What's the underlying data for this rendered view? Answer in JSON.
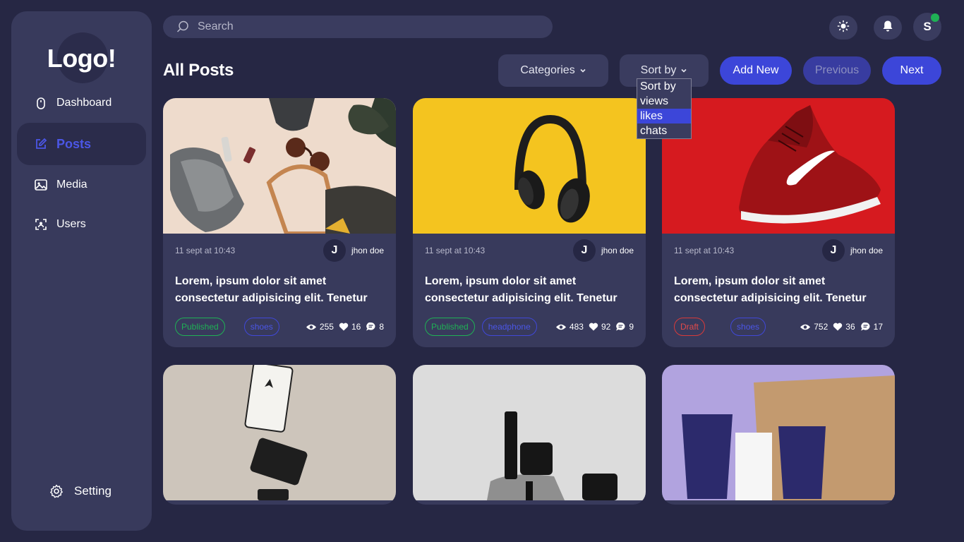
{
  "sidebar": {
    "logo": "Logo!",
    "items": [
      {
        "label": "Dashboard",
        "icon": "mouse-icon"
      },
      {
        "label": "Posts",
        "icon": "edit-icon",
        "active": true
      },
      {
        "label": "Media",
        "icon": "image-icon"
      },
      {
        "label": "Users",
        "icon": "user-scan-icon"
      }
    ],
    "setting": {
      "label": "Setting",
      "icon": "gear-icon"
    }
  },
  "header": {
    "search_placeholder": "Search",
    "avatar_letter": "S"
  },
  "page": {
    "title": "All Posts",
    "categories_label": "Categories",
    "sort_label": "Sort by",
    "add_new_label": "Add New",
    "previous_label": "Previous",
    "next_label": "Next"
  },
  "sort_dropdown": {
    "options": [
      "Sort by",
      "views",
      "likes",
      "chats"
    ],
    "highlighted": "likes"
  },
  "posts": [
    {
      "date": "11 sept at 10:43",
      "author_initial": "J",
      "author": "jhon doe",
      "title": "Lorem, ipsum dolor sit amet consectetur adipisicing elit. Tenetur",
      "status": "Published",
      "category": "shoes",
      "views": "255",
      "likes": "16",
      "chats": "8",
      "image": "flatlay-shoes"
    },
    {
      "date": "11 sept at 10:43",
      "author_initial": "J",
      "author": "jhon doe",
      "title": "Lorem, ipsum dolor sit amet consectetur adipisicing elit. Tenetur",
      "status": "Published",
      "category": "headphone",
      "views": "483",
      "likes": "92",
      "chats": "9",
      "image": "headphones-yellow"
    },
    {
      "date": "11 sept at 10:43",
      "author_initial": "J",
      "author": "jhon doe",
      "title": "Lorem, ipsum dolor sit amet consectetur adipisicing elit. Tenetur",
      "status": "Draft",
      "category": "shoes",
      "views": "752",
      "likes": "36",
      "chats": "17",
      "image": "red-sneaker"
    },
    {
      "image": "hemp-seed-bottles"
    },
    {
      "image": "skincare-rocks"
    },
    {
      "image": "curology-box"
    }
  ],
  "colors": {
    "background": "#262744",
    "panel": "#383a5c",
    "accent": "#3c46d9",
    "published": "#1fb155",
    "draft": "#d83a3a",
    "online": "#1fb155"
  }
}
